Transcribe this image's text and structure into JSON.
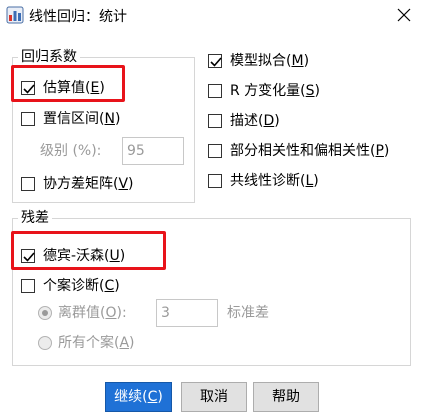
{
  "window": {
    "title": "线性回归：统计",
    "close_glyph": "✕"
  },
  "coefficients_group": {
    "legend": "回归系数",
    "estimates": {
      "label": "估算值(",
      "mnemonic": "E",
      "suffix": ")",
      "checked": true
    },
    "confidence_intervals": {
      "label": "置信区间(",
      "mnemonic": "N",
      "suffix": ")",
      "checked": false
    },
    "level_label": "级别 (%):",
    "level_value": "95",
    "covariance_matrix": {
      "label": "协方差矩阵(",
      "mnemonic": "V",
      "suffix": ")",
      "checked": false
    }
  },
  "right_options": {
    "model_fit": {
      "label": "模型拟合(",
      "mnemonic": "M",
      "suffix": ")",
      "checked": true
    },
    "r_squared_change": {
      "label": "R 方变化量(",
      "mnemonic": "S",
      "suffix": ")",
      "checked": false
    },
    "descriptives": {
      "label": "描述(",
      "mnemonic": "D",
      "suffix": ")",
      "checked": false
    },
    "part_partial": {
      "label": "部分相关性和偏相关性(",
      "mnemonic": "P",
      "suffix": ")",
      "checked": false
    },
    "collinearity": {
      "label": "共线性诊断(",
      "mnemonic": "L",
      "suffix": ")",
      "checked": false
    }
  },
  "residuals_group": {
    "legend": "残差",
    "durbin_watson": {
      "label": "德宾-沃森(",
      "mnemonic": "U",
      "suffix": ")",
      "checked": true
    },
    "casewise": {
      "label": "个案诊断(",
      "mnemonic": "C",
      "suffix": ")",
      "checked": false
    },
    "outliers": {
      "label": "离群值(",
      "mnemonic": "O",
      "suffix": "):",
      "selected": true
    },
    "outliers_value": "3",
    "std_unit": "标准差",
    "all_cases": {
      "label": "所有个案(",
      "mnemonic": "A",
      "suffix": ")",
      "selected": false
    }
  },
  "buttons": {
    "continue": {
      "label": "继续(",
      "mnemonic": "C",
      "suffix": ")"
    },
    "cancel": "取消",
    "help": "帮助"
  },
  "colors": {
    "highlight": "#e8131a",
    "primary_button": "#1f71d6"
  }
}
